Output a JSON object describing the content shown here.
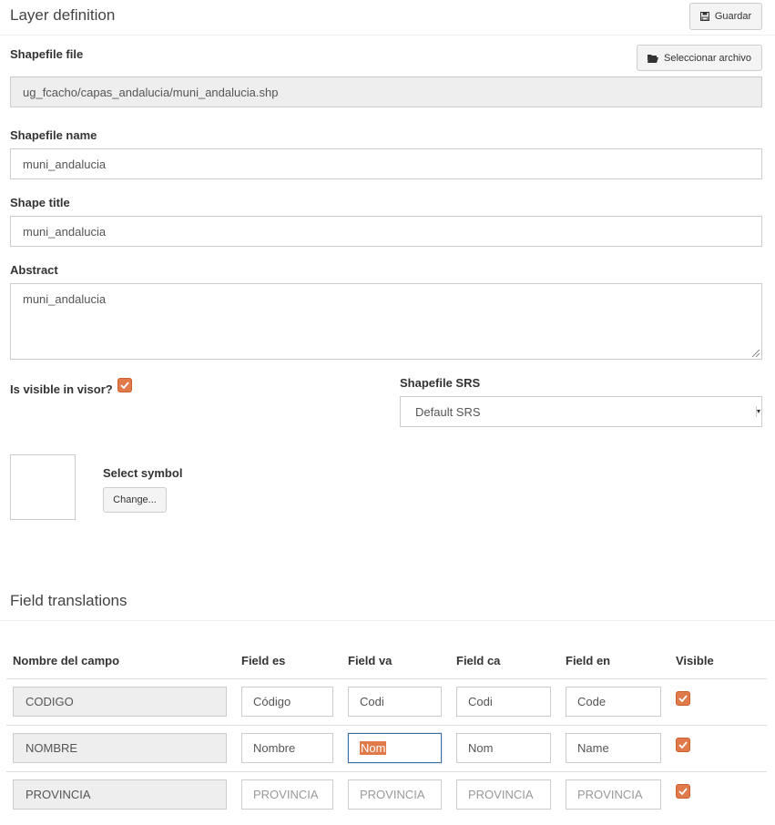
{
  "header": {
    "title": "Layer definition",
    "save_label": "Guardar"
  },
  "shapefile_file": {
    "label": "Shapefile file",
    "value": "ug_fcacho/capas_andalucia/muni_andalucia.shp",
    "select_label": "Seleccionar archivo"
  },
  "shapefile_name": {
    "label": "Shapefile name",
    "value": "muni_andalucia"
  },
  "shape_title": {
    "label": "Shape title",
    "value": "muni_andalucia"
  },
  "abstract": {
    "label": "Abstract",
    "value": "muni_andalucia"
  },
  "visible": {
    "label": "Is visible in visor?",
    "checked": true
  },
  "srs": {
    "label": "Shapefile SRS",
    "selected": "Default SRS"
  },
  "symbol": {
    "label": "Select symbol",
    "change_label": "Change..."
  },
  "translations": {
    "title": "Field translations",
    "headers": [
      "Nombre del campo",
      "Field es",
      "Field va",
      "Field ca",
      "Field en",
      "Visible"
    ],
    "rows": [
      {
        "name": "CODIGO",
        "es": "Código",
        "va": "Codi",
        "ca": "Codi",
        "en": "Code",
        "visible": true
      },
      {
        "name": "NOMBRE",
        "es": "Nombre",
        "va": "Nom",
        "ca": "Nom",
        "en": "Name",
        "visible": true
      },
      {
        "name": "PROVINCIA",
        "es": "PROVINCIA",
        "va": "PROVINCIA",
        "ca": "PROVINCIA",
        "en": "PROVINCIA",
        "visible": true
      }
    ]
  },
  "colors": {
    "accent": "#e07a4a",
    "focus_border": "#3a6ea5",
    "readonly_bg": "#eeeeee"
  },
  "icons": {
    "save": "floppy-disk-icon",
    "file": "folder-open-icon",
    "check": "check-icon"
  }
}
